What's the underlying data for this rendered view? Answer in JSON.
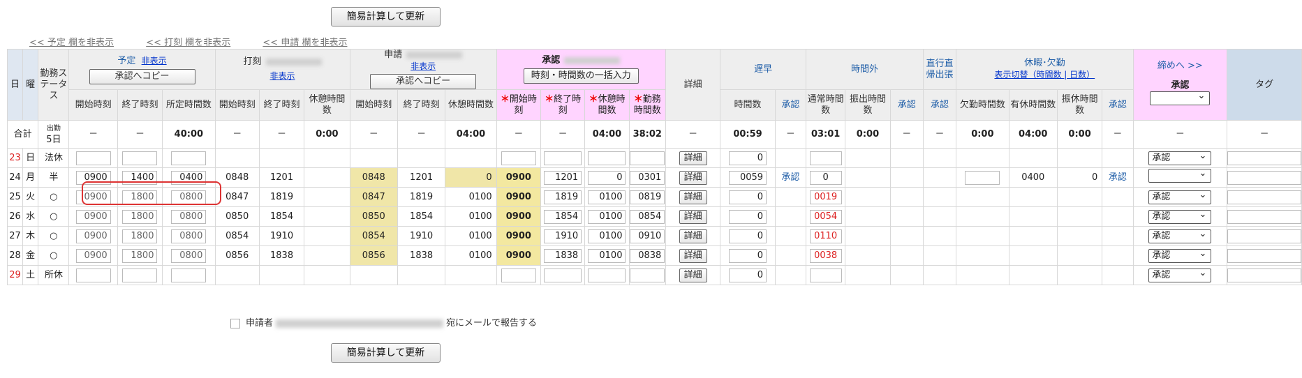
{
  "buttons": {
    "recalc": "簡易計算して更新",
    "copy_plan": "承認へコピー",
    "copy_request": "承認へコピー",
    "bulk_input": "時刻・時間数の一括入力",
    "detail": "詳細"
  },
  "toplinks": [
    "<< 予定 欄を非表示",
    "<< 打刻 欄を非表示",
    "<< 申請 欄を非表示"
  ],
  "headers": {
    "day": "日",
    "weekday": "曜",
    "status": "勤務ステータス",
    "plan": "予定",
    "hide": "非表示",
    "stamp": "打刻",
    "request": "申請",
    "approve": "承認",
    "detail": "詳細",
    "late_early": "遅早",
    "overtime": "時間外",
    "direct": "直行直帰出張",
    "leave": "休暇･欠勤",
    "leave_toggle": "表示切替（時間数 | 日数）",
    "close": "締めへ >>",
    "close_approve": "承認",
    "tag": "タグ",
    "start": "開始時刻",
    "end": "終了時刻",
    "scheduled": "所定時間数",
    "break": "休憩時間数",
    "work": "勤務時間数",
    "hours": "時間数",
    "approve_col": "承認",
    "normal": "通常時間数",
    "transfer": "振出時間数",
    "absence": "欠勤時間数",
    "paid": "有休時間数",
    "comp": "振休時間数"
  },
  "totals": {
    "label": "合計",
    "days_label": "出勤",
    "days": "5日",
    "plan_sched": "40:00",
    "stamp_break": "0:00",
    "req_break": "04:00",
    "app_break": "04:00",
    "app_work": "38:02",
    "late": "00:59",
    "normal": "03:01",
    "transfer": "0:00",
    "absence": "0:00",
    "paid": "04:00",
    "comp": "0:00",
    "dash": "－"
  },
  "rows": [
    {
      "day": "23",
      "wd": "日",
      "st": "法休",
      "ps": "",
      "pe": "",
      "pd": "",
      "ss": "",
      "se": "",
      "sb": "",
      "rs": "",
      "re": "",
      "rb": "",
      "as": "",
      "ae": "",
      "ab": "",
      "aw": "",
      "late": "0",
      "lateApp": "",
      "norm": "",
      "abs": "",
      "paid": "",
      "comp": "",
      "compApp": "",
      "sel": "承認",
      "red": true
    },
    {
      "day": "24",
      "wd": "月",
      "st": "半",
      "ps": "0900",
      "pe": "1400",
      "pd": "0400",
      "ss": "0848",
      "se": "1201",
      "sb": "",
      "rs": "0848",
      "re": "1201",
      "rb": "0",
      "as": "0900",
      "ae": "1201",
      "ab": "0",
      "aw": "0301",
      "late": "0059",
      "lateApp": "承認",
      "norm": "0",
      "abs": "",
      "paid": "0400",
      "comp": "0",
      "compApp": "承認",
      "sel": "",
      "red": false
    },
    {
      "day": "25",
      "wd": "火",
      "st": "○",
      "ps": "0900",
      "pe": "1800",
      "pd": "0800",
      "ss": "0847",
      "se": "1819",
      "sb": "",
      "rs": "0847",
      "re": "1819",
      "rb": "0100",
      "as": "0900",
      "ae": "1819",
      "ab": "0100",
      "aw": "0819",
      "late": "0",
      "lateApp": "",
      "norm": "0019",
      "abs": "",
      "paid": "",
      "comp": "",
      "compApp": "",
      "sel": "承認",
      "red": false
    },
    {
      "day": "26",
      "wd": "水",
      "st": "○",
      "ps": "0900",
      "pe": "1800",
      "pd": "0800",
      "ss": "0850",
      "se": "1854",
      "sb": "",
      "rs": "0850",
      "re": "1854",
      "rb": "0100",
      "as": "0900",
      "ae": "1854",
      "ab": "0100",
      "aw": "0854",
      "late": "0",
      "lateApp": "",
      "norm": "0054",
      "abs": "",
      "paid": "",
      "comp": "",
      "compApp": "",
      "sel": "承認",
      "red": false
    },
    {
      "day": "27",
      "wd": "木",
      "st": "○",
      "ps": "0900",
      "pe": "1800",
      "pd": "0800",
      "ss": "0854",
      "se": "1910",
      "sb": "",
      "rs": "0854",
      "re": "1910",
      "rb": "0100",
      "as": "0900",
      "ae": "1910",
      "ab": "0100",
      "aw": "0910",
      "late": "0",
      "lateApp": "",
      "norm": "0110",
      "abs": "",
      "paid": "",
      "comp": "",
      "compApp": "",
      "sel": "承認",
      "red": false
    },
    {
      "day": "28",
      "wd": "金",
      "st": "○",
      "ps": "0900",
      "pe": "1800",
      "pd": "0800",
      "ss": "0856",
      "se": "1838",
      "sb": "",
      "rs": "0856",
      "re": "1838",
      "rb": "0100",
      "as": "0900",
      "ae": "1838",
      "ab": "0100",
      "aw": "0838",
      "late": "0",
      "lateApp": "",
      "norm": "0038",
      "abs": "",
      "paid": "",
      "comp": "",
      "compApp": "",
      "sel": "承認",
      "red": false
    },
    {
      "day": "29",
      "wd": "土",
      "st": "所休",
      "ps": "",
      "pe": "",
      "pd": "",
      "ss": "",
      "se": "",
      "sb": "",
      "rs": "",
      "re": "",
      "rb": "",
      "as": "",
      "ae": "",
      "ab": "",
      "aw": "",
      "late": "0",
      "lateApp": "",
      "norm": "",
      "abs": "",
      "paid": "",
      "comp": "",
      "compApp": "",
      "sel": "承認",
      "red": true
    }
  ],
  "mail": {
    "label_applicant": "申請者",
    "label_suffix": "宛にメールで報告する"
  }
}
